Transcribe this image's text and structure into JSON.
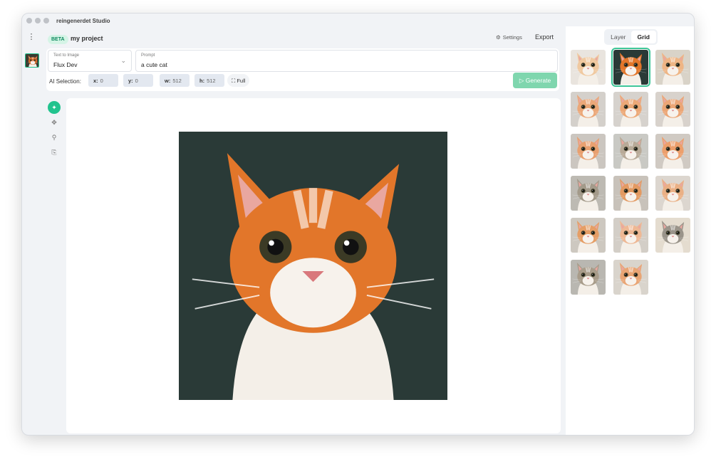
{
  "window": {
    "title": "reingenerdet Studio"
  },
  "header": {
    "badge": "BETA",
    "project": "my project",
    "settings_label": "Settings",
    "export_label": "Export"
  },
  "controls": {
    "mode": {
      "label": "Text to Image",
      "value": "Flux Dev"
    },
    "prompt": {
      "label": "Prompt",
      "value": "a cute cat"
    },
    "ai_selection_label": "AI Selection:",
    "x": {
      "label": "x:",
      "value": "0"
    },
    "y": {
      "label": "y:",
      "value": "0"
    },
    "w": {
      "label": "w:",
      "value": "512"
    },
    "h": {
      "label": "h:",
      "value": "512"
    },
    "full_label": "Full",
    "generate_label": "Generate"
  },
  "tools": [
    "sparkle-icon",
    "move-icon",
    "zoom-icon",
    "stamp-icon"
  ],
  "right_panel": {
    "tabs": [
      "Layer",
      "Grid"
    ],
    "active_tab": "Grid",
    "selected_index": 1,
    "thumbnail_count": 17
  },
  "colors": {
    "accent": "#22c38e",
    "generate": "#7fd6ae",
    "beta_bg": "#d5f4e6"
  }
}
